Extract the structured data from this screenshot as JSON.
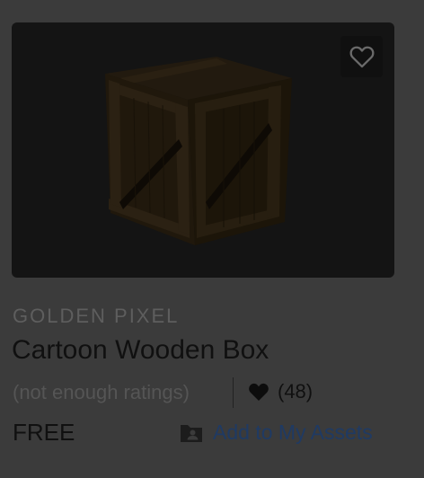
{
  "asset": {
    "publisher": "GOLDEN PIXEL",
    "title": "Cartoon Wooden Box",
    "ratings_text": "(not enough ratings)",
    "likes_count": "(48)",
    "price": "FREE",
    "add_label": "Add to My Assets"
  },
  "icons": {
    "favorite": "heart-outline-icon",
    "likes": "heart-filled-icon",
    "add": "folder-user-icon"
  },
  "colors": {
    "background": "#3b3b3b",
    "thumbnail_bg": "#141414",
    "link": "#1f3a63",
    "text": "#101010",
    "muted": "#5e5e5e"
  }
}
